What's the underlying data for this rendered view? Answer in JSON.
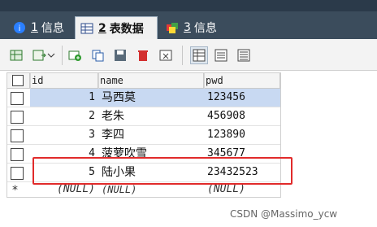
{
  "tabs": [
    {
      "num": "1",
      "label": "信息"
    },
    {
      "num": "2",
      "label": "表数据"
    },
    {
      "num": "3",
      "label": "信息"
    }
  ],
  "grid": {
    "columns": [
      "id",
      "name",
      "pwd"
    ],
    "rows": [
      {
        "id": "1",
        "name": "马西莫",
        "pwd": "123456"
      },
      {
        "id": "2",
        "name": "老朱",
        "pwd": "456908"
      },
      {
        "id": "3",
        "name": "李四",
        "pwd": "123890"
      },
      {
        "id": "4",
        "name": "菠萝吹雪",
        "pwd": "345677"
      },
      {
        "id": "5",
        "name": "陆小果",
        "pwd": "23432523"
      }
    ],
    "null_row": {
      "marker": "*",
      "id": "(NULL)",
      "name": "(NULL)",
      "pwd": "(NULL)"
    },
    "colors": {
      "selected_row": "#c8d9f2",
      "highlight_box": "#e12b2b"
    }
  },
  "toolbar": {
    "icons": [
      "grid-export-icon",
      "import-dropdown-icon",
      "add-row-icon",
      "duplicate-row-icon",
      "save-icon",
      "delete-icon",
      "refresh-icon",
      "grid-view-icon",
      "form-view-icon",
      "text-view-icon"
    ]
  },
  "watermark": "CSDN @Massimo_ycw"
}
